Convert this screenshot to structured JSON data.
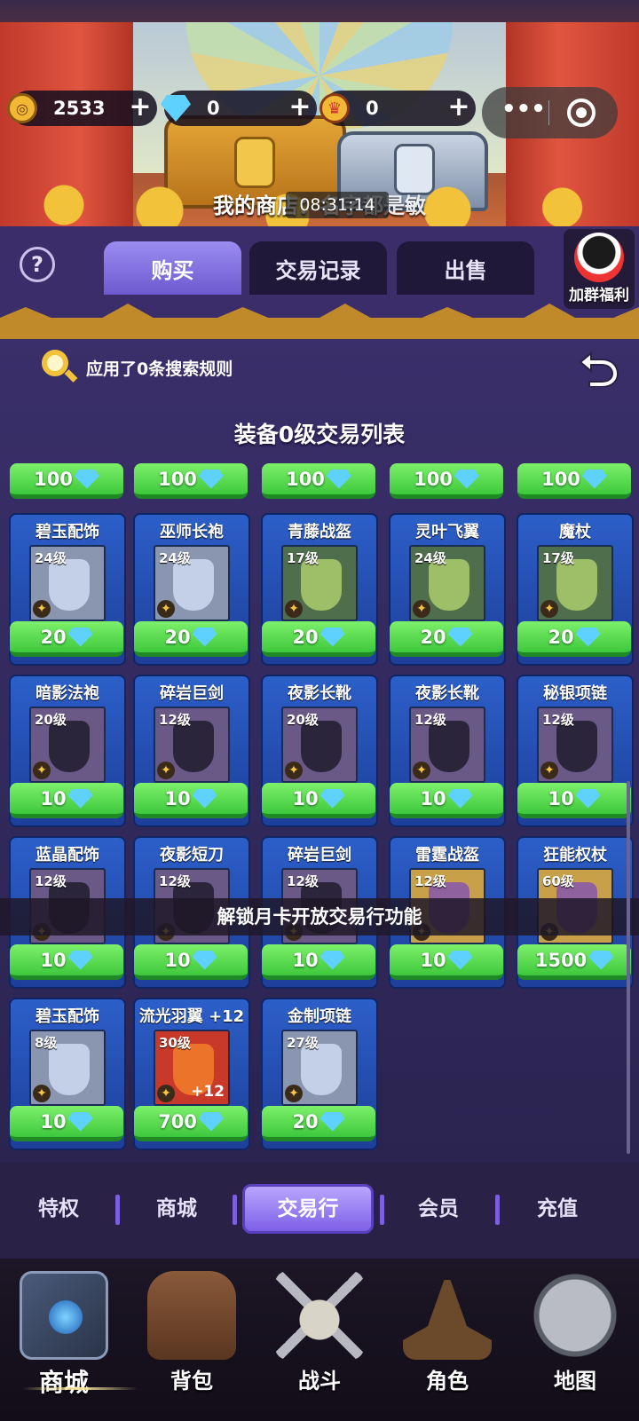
{
  "currency": {
    "gold": "2533",
    "diamond": "0",
    "crown": "0"
  },
  "banner": {
    "title": "我的商店：",
    "owner_hint": "名字都是敏",
    "time": "08:31:14"
  },
  "tabs": [
    {
      "label": "购买",
      "active": true
    },
    {
      "label": "交易记录",
      "active": false
    },
    {
      "label": "出售",
      "active": false
    }
  ],
  "help_label": "?",
  "group_btn": {
    "label": "加群福利"
  },
  "search": {
    "text": "应用了0条搜索规则"
  },
  "list_title": "装备0级交易列表",
  "top_prices": [
    "100",
    "100",
    "100",
    "100",
    "100"
  ],
  "items": [
    {
      "name": "碧玉配饰",
      "level": "24级",
      "price": "20",
      "icon": "jade-accessory-icon",
      "tone": "grey"
    },
    {
      "name": "巫师长袍",
      "level": "24级",
      "price": "20",
      "icon": "wizard-robe-icon",
      "tone": "grey"
    },
    {
      "name": "青藤战盔",
      "level": "17级",
      "price": "20",
      "icon": "vine-helmet-icon",
      "tone": "green"
    },
    {
      "name": "灵叶飞翼",
      "level": "24级",
      "price": "20",
      "icon": "leaf-wings-icon",
      "tone": "green"
    },
    {
      "name": "魔杖",
      "level": "17级",
      "price": "20",
      "icon": "magic-wand-icon",
      "tone": "green"
    },
    {
      "name": "暗影法袍",
      "level": "20级",
      "price": "10",
      "icon": "shadow-robe-icon",
      "tone": "purple"
    },
    {
      "name": "碎岩巨剑",
      "level": "12级",
      "price": "10",
      "icon": "rock-greatsword-icon",
      "tone": "purple"
    },
    {
      "name": "夜影长靴",
      "level": "20级",
      "price": "10",
      "icon": "night-boots-icon",
      "tone": "purple"
    },
    {
      "name": "夜影长靴",
      "level": "12级",
      "price": "10",
      "icon": "night-boots-icon",
      "tone": "purple"
    },
    {
      "name": "秘银项链",
      "level": "12级",
      "price": "10",
      "icon": "mithril-necklace-icon",
      "tone": "purple"
    },
    {
      "name": "蓝晶配饰",
      "level": "12级",
      "price": "10",
      "icon": "crystal-accessory-icon",
      "tone": "purple"
    },
    {
      "name": "夜影短刀",
      "level": "12级",
      "price": "10",
      "icon": "night-dagger-icon",
      "tone": "purple"
    },
    {
      "name": "碎岩巨剑",
      "level": "12级",
      "price": "10",
      "icon": "rock-greatsword-icon",
      "tone": "purple"
    },
    {
      "name": "雷霆战盔",
      "level": "12级",
      "price": "10",
      "icon": "thunder-helmet-icon",
      "tone": "gold"
    },
    {
      "name": "狂能权杖",
      "level": "60级",
      "price": "1500",
      "icon": "power-scepter-icon",
      "tone": "gold"
    },
    {
      "name": "碧玉配饰",
      "level": "8级",
      "price": "10",
      "icon": "jade-accessory-icon",
      "tone": "grey"
    },
    {
      "name": "流光羽翼 +12",
      "level": "30级",
      "price": "700",
      "icon": "glow-wings-icon",
      "tone": "red",
      "plus": "+12"
    },
    {
      "name": "金制项链",
      "level": "27级",
      "price": "20",
      "icon": "gold-necklace-icon",
      "tone": "grey"
    }
  ],
  "lock_notice": "解锁月卡开放交易行功能",
  "subnav": [
    {
      "label": "特权"
    },
    {
      "label": "商城"
    },
    {
      "label": "交易行",
      "active": true
    },
    {
      "label": "会员"
    },
    {
      "label": "充值"
    }
  ],
  "bottom_nav": [
    {
      "label": "商城",
      "icon": "spellbook-icon",
      "active": true
    },
    {
      "label": "背包",
      "icon": "backpack-icon"
    },
    {
      "label": "战斗",
      "icon": "crossed-swords-skull-icon"
    },
    {
      "label": "角色",
      "icon": "wizard-hat-icon"
    },
    {
      "label": "地图",
      "icon": "map-icon"
    }
  ],
  "colors": {
    "accent": "#7d60e6",
    "price_green": "#3ec83d",
    "card_blue": "#2c5fc9"
  }
}
